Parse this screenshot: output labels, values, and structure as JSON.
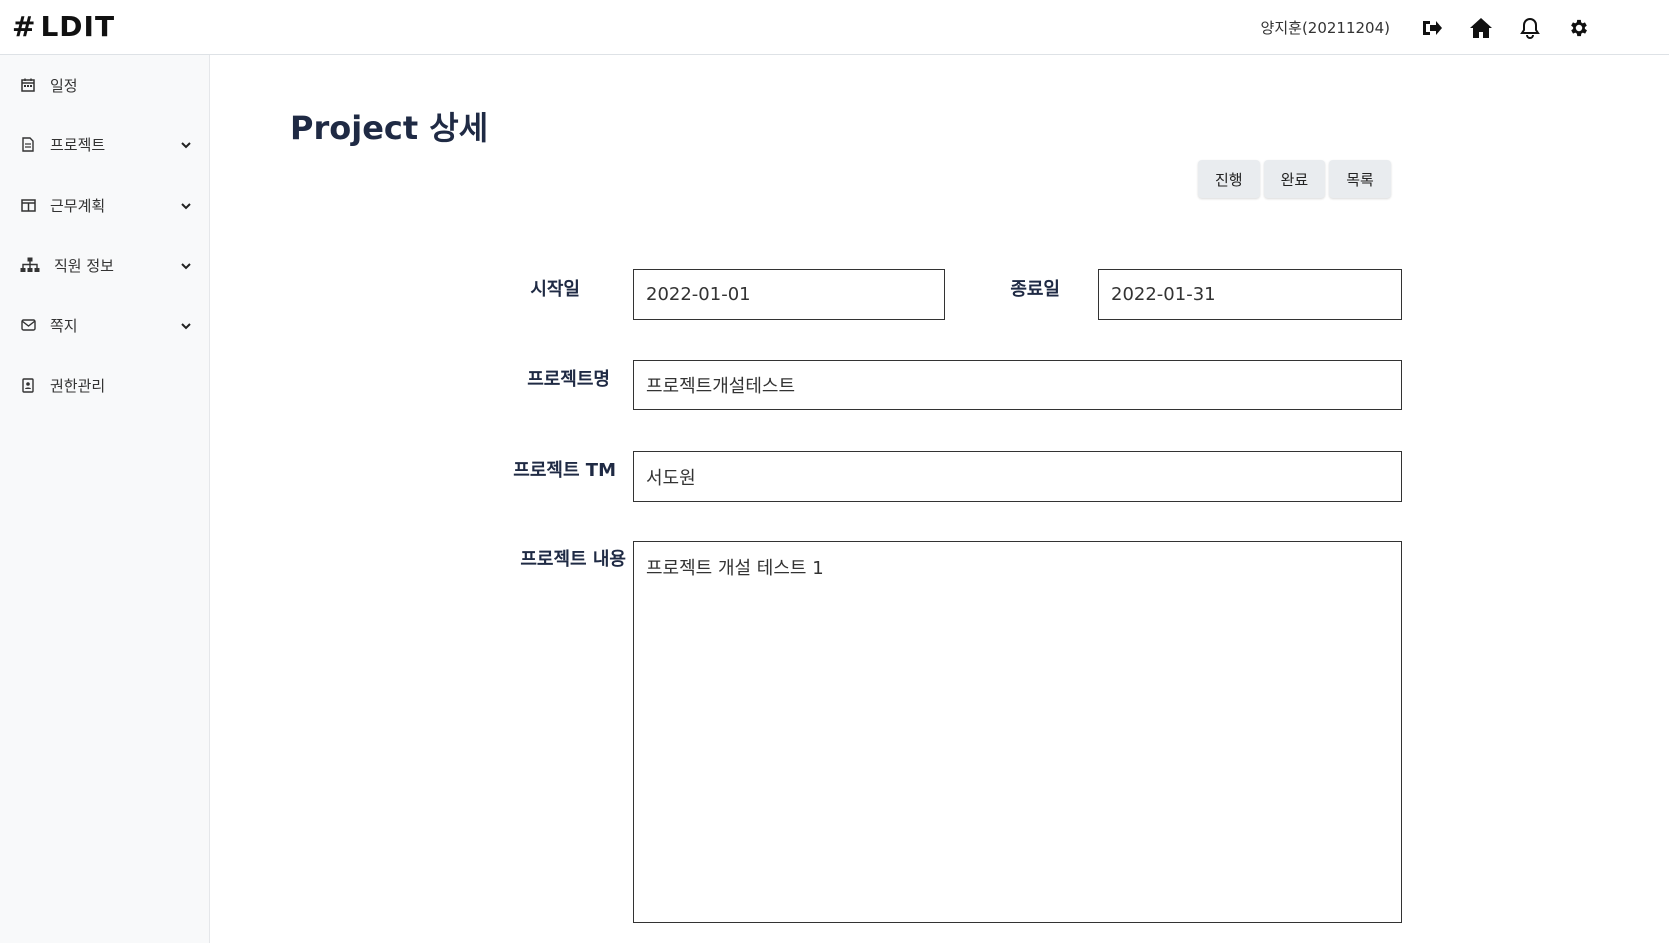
{
  "header": {
    "logo_hash": "#",
    "brand": "LDIT",
    "user": "양지훈(20211204)",
    "icons": [
      "logout-icon",
      "home-icon",
      "bell-icon",
      "settings-icon"
    ]
  },
  "sidebar": {
    "items": [
      {
        "label": "일정",
        "icon": "calendar-icon",
        "has_children": false
      },
      {
        "label": "프로젝트",
        "icon": "document-icon",
        "has_children": true
      },
      {
        "label": "근무계획",
        "icon": "columns-icon",
        "has_children": true
      },
      {
        "label": "직원 정보",
        "icon": "org-chart-icon",
        "has_children": true
      },
      {
        "label": "쪽지",
        "icon": "envelope-icon",
        "has_children": true
      },
      {
        "label": "권한관리",
        "icon": "id-badge-icon",
        "has_children": false
      }
    ]
  },
  "main": {
    "title": "Project 상세",
    "buttons": {
      "progress": "진행",
      "complete": "완료",
      "list": "목록"
    },
    "form": {
      "start_label": "시작일",
      "start_value": "2022-01-01",
      "end_label": "종료일",
      "end_value": "2022-01-31",
      "name_label": "프로젝트명",
      "name_value": "프로젝트개설테스트",
      "tm_label": "프로젝트 TM",
      "tm_value": "서도원",
      "content_label": "프로젝트 내용",
      "content_value": "프로젝트 개설 테스트 1"
    }
  },
  "colors": {
    "title": "#1f2a44",
    "sidebar_bg": "#f8f9fa",
    "button_bg": "#e9ecef"
  }
}
